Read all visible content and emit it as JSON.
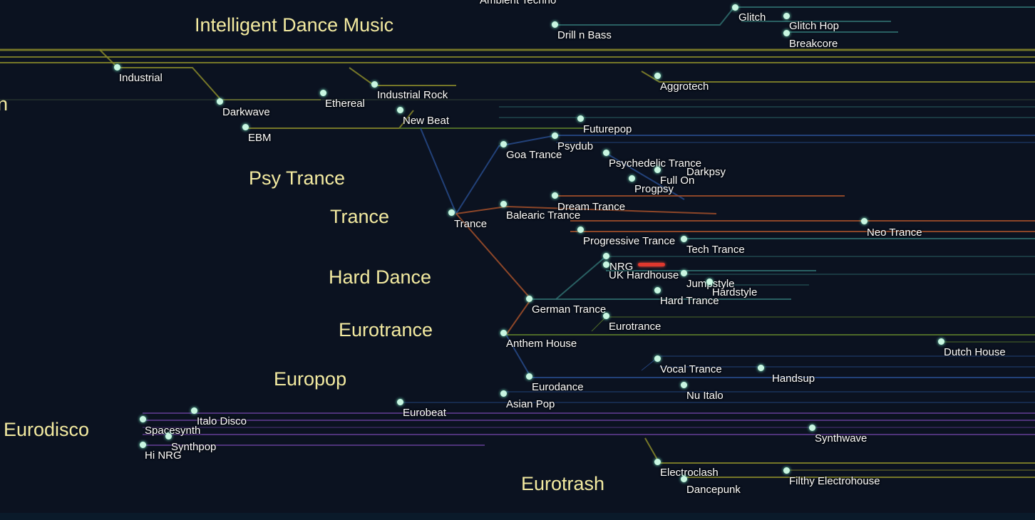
{
  "colors": {
    "background": "#0b1220",
    "group_label": "#f3eaa0",
    "node_dot": "#c9f7e2",
    "now_playing": "#e0382e",
    "line_olive": "#8a8a2a",
    "line_teal": "#2f6f6f",
    "line_blue": "#274a8a",
    "line_orange": "#a4502a",
    "line_purple": "#5a3a8a",
    "line_green": "#5a7a2a"
  },
  "groups": [
    {
      "id": "idm",
      "label": "Intelligent Dance Music"
    },
    {
      "id": "n",
      "label": "n"
    },
    {
      "id": "psytrance",
      "label": "Psy Trance"
    },
    {
      "id": "trance",
      "label": "Trance"
    },
    {
      "id": "harddance",
      "label": "Hard Dance"
    },
    {
      "id": "eurotrance",
      "label": "Eurotrance"
    },
    {
      "id": "europop",
      "label": "Europop"
    },
    {
      "id": "eurodisco",
      "label": "Eurodisco"
    },
    {
      "id": "eurotrash",
      "label": "Eurotrash"
    }
  ],
  "nodes": [
    {
      "id": "ambient-techno",
      "label": "Ambient Techno"
    },
    {
      "id": "glitch",
      "label": "Glitch"
    },
    {
      "id": "glitch-hop",
      "label": "Glitch Hop"
    },
    {
      "id": "breakcore",
      "label": "Breakcore"
    },
    {
      "id": "drill-n-bass",
      "label": "Drill n Bass"
    },
    {
      "id": "industrial",
      "label": "Industrial"
    },
    {
      "id": "aggrotech",
      "label": "Aggrotech"
    },
    {
      "id": "industrial-rock",
      "label": "Industrial Rock"
    },
    {
      "id": "ethereal",
      "label": "Ethereal"
    },
    {
      "id": "darkwave",
      "label": "Darkwave"
    },
    {
      "id": "new-beat",
      "label": "New Beat"
    },
    {
      "id": "ebm",
      "label": "EBM"
    },
    {
      "id": "futurepop",
      "label": "Futurepop"
    },
    {
      "id": "psydub",
      "label": "Psydub"
    },
    {
      "id": "goa-trance",
      "label": "Goa Trance"
    },
    {
      "id": "psychedelic-trance",
      "label": "Psychedelic Trance"
    },
    {
      "id": "darkpsy",
      "label": "Darkpsy"
    },
    {
      "id": "full-on",
      "label": "Full On"
    },
    {
      "id": "progpsy",
      "label": "Progpsy"
    },
    {
      "id": "dream-trance",
      "label": "Dream Trance"
    },
    {
      "id": "balearic-trance",
      "label": "Balearic Trance"
    },
    {
      "id": "trance",
      "label": "Trance"
    },
    {
      "id": "progressive-trance",
      "label": "Progressive Trance"
    },
    {
      "id": "neo-trance",
      "label": "Neo Trance"
    },
    {
      "id": "tech-trance",
      "label": "Tech Trance"
    },
    {
      "id": "nrg",
      "label": "NRG"
    },
    {
      "id": "uk-hardhouse",
      "label": "UK Hardhouse"
    },
    {
      "id": "jumpstyle",
      "label": "Jumpstyle"
    },
    {
      "id": "hardstyle",
      "label": "Hardstyle"
    },
    {
      "id": "hard-trance",
      "label": "Hard Trance"
    },
    {
      "id": "german-trance",
      "label": "German Trance"
    },
    {
      "id": "eurotrance",
      "label": "Eurotrance"
    },
    {
      "id": "anthem-house",
      "label": "Anthem House"
    },
    {
      "id": "dutch-house",
      "label": "Dutch House"
    },
    {
      "id": "vocal-trance",
      "label": "Vocal Trance"
    },
    {
      "id": "handsup",
      "label": "Handsup"
    },
    {
      "id": "eurodance",
      "label": "Eurodance"
    },
    {
      "id": "nu-italo",
      "label": "Nu Italo"
    },
    {
      "id": "asian-pop",
      "label": "Asian Pop"
    },
    {
      "id": "eurobeat",
      "label": "Eurobeat"
    },
    {
      "id": "italo-disco",
      "label": "Italo Disco"
    },
    {
      "id": "spacesynth",
      "label": "Spacesynth"
    },
    {
      "id": "synthpop",
      "label": "Synthpop"
    },
    {
      "id": "hi-nrg",
      "label": "Hi NRG"
    },
    {
      "id": "synthwave",
      "label": "Synthwave"
    },
    {
      "id": "electroclash",
      "label": "Electroclash"
    },
    {
      "id": "dancepunk",
      "label": "Dancepunk"
    },
    {
      "id": "filthy-electrohouse",
      "label": "Filthy Electrohouse"
    }
  ]
}
